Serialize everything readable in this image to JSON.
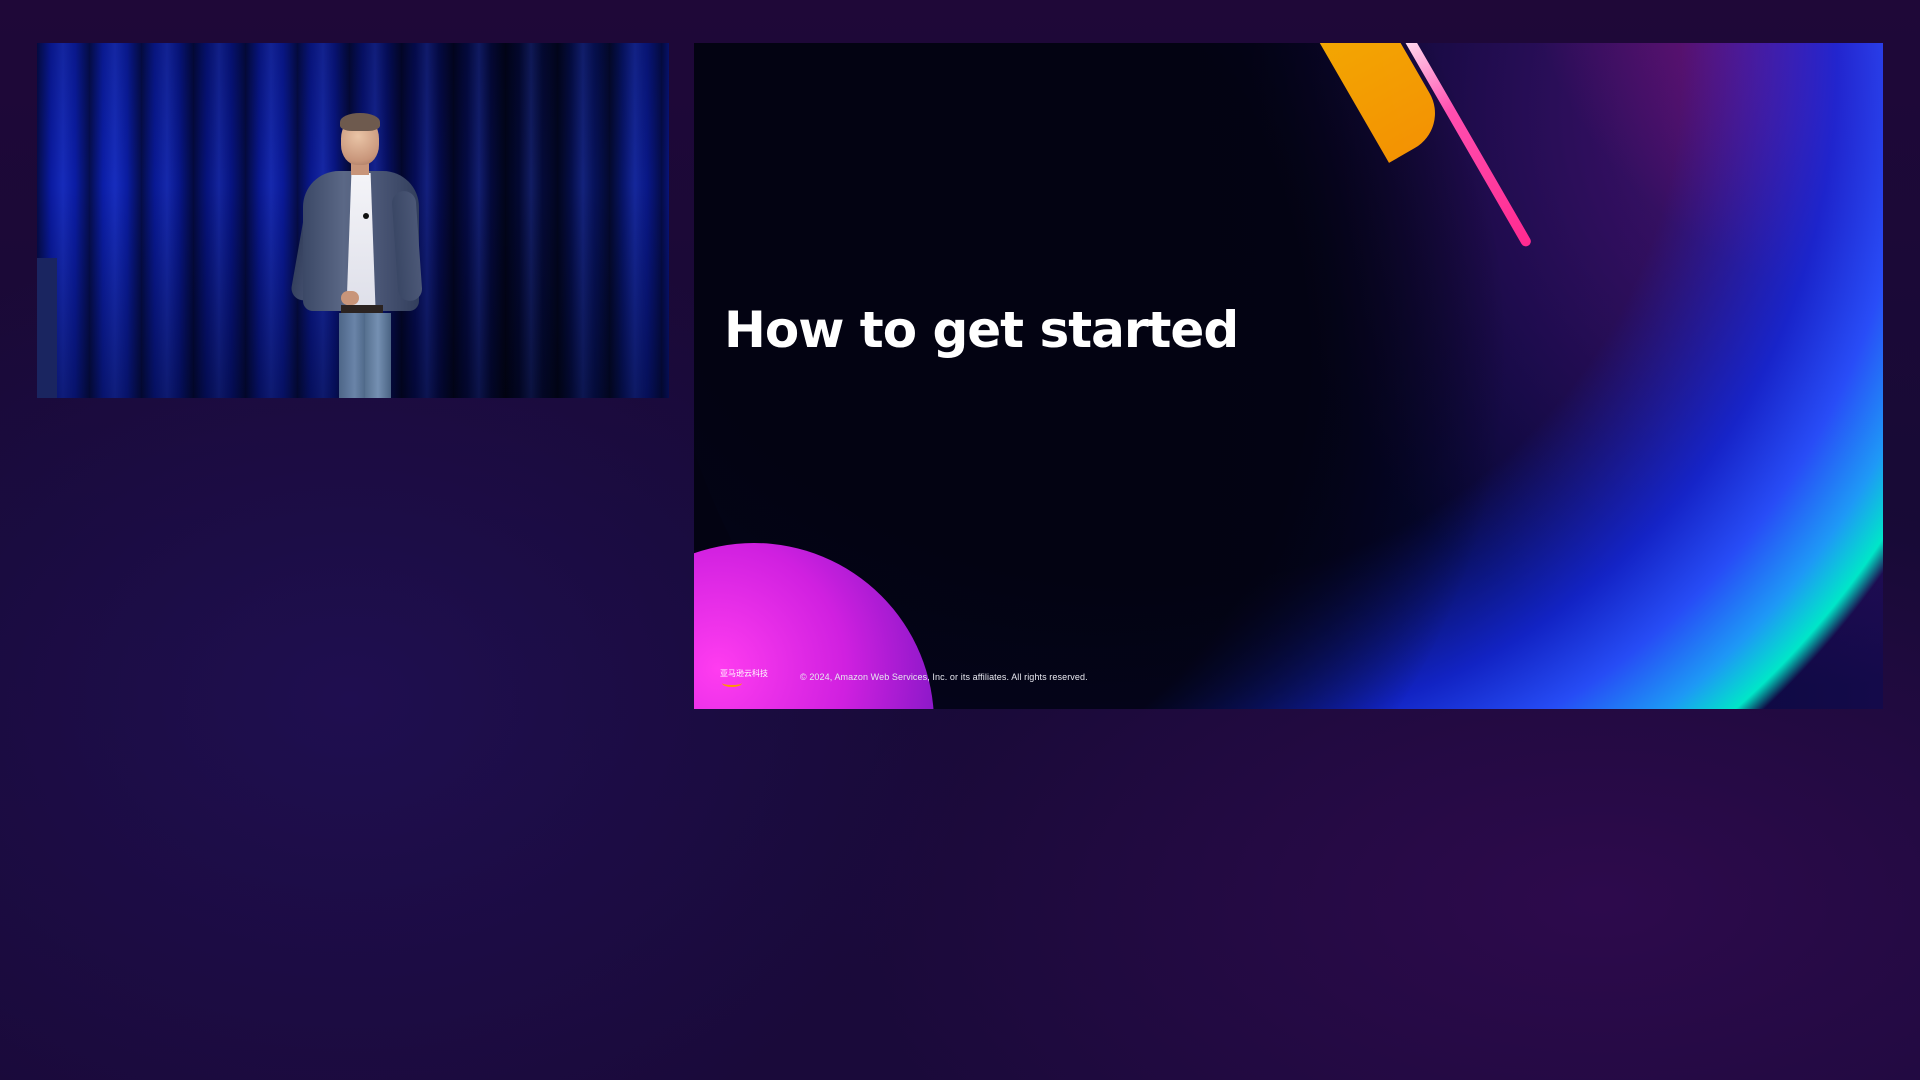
{
  "slide": {
    "title": "How to get started",
    "logo_text": "亚马逊云科技",
    "copyright": "© 2024, Amazon Web Services, Inc. or its affiliates. All rights reserved."
  },
  "colors": {
    "background": "#1a0838",
    "accent_teal": "#00f0c0",
    "accent_blue": "#2040ff",
    "accent_magenta": "#d020e0",
    "accent_pink": "#ff2a90",
    "accent_orange": "#ffb000"
  },
  "icons": {
    "logo": "aws-china-logo"
  }
}
